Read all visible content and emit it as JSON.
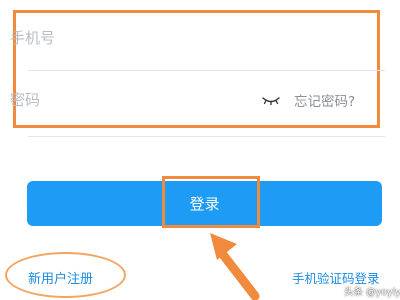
{
  "login_form": {
    "phone_placeholder": "手机号",
    "password_placeholder": "密码",
    "password_toggle_icon": "closed-eye-icon",
    "forgot_password_label": "忘记密码?"
  },
  "actions": {
    "login_label": "登录",
    "register_label": "新用户注册",
    "sms_login_label": "手机验证码登录"
  },
  "annotations": {
    "highlight_color": "#f08a3c",
    "arrow_icon": "arrow-up-left-icon"
  },
  "watermark": {
    "text": "头条 @yoyiyoi"
  },
  "colors": {
    "primary_button": "#1d9bf5",
    "link": "#1d8ce0",
    "placeholder": "#b8bcc4",
    "secondary_text": "#8a8f98"
  }
}
